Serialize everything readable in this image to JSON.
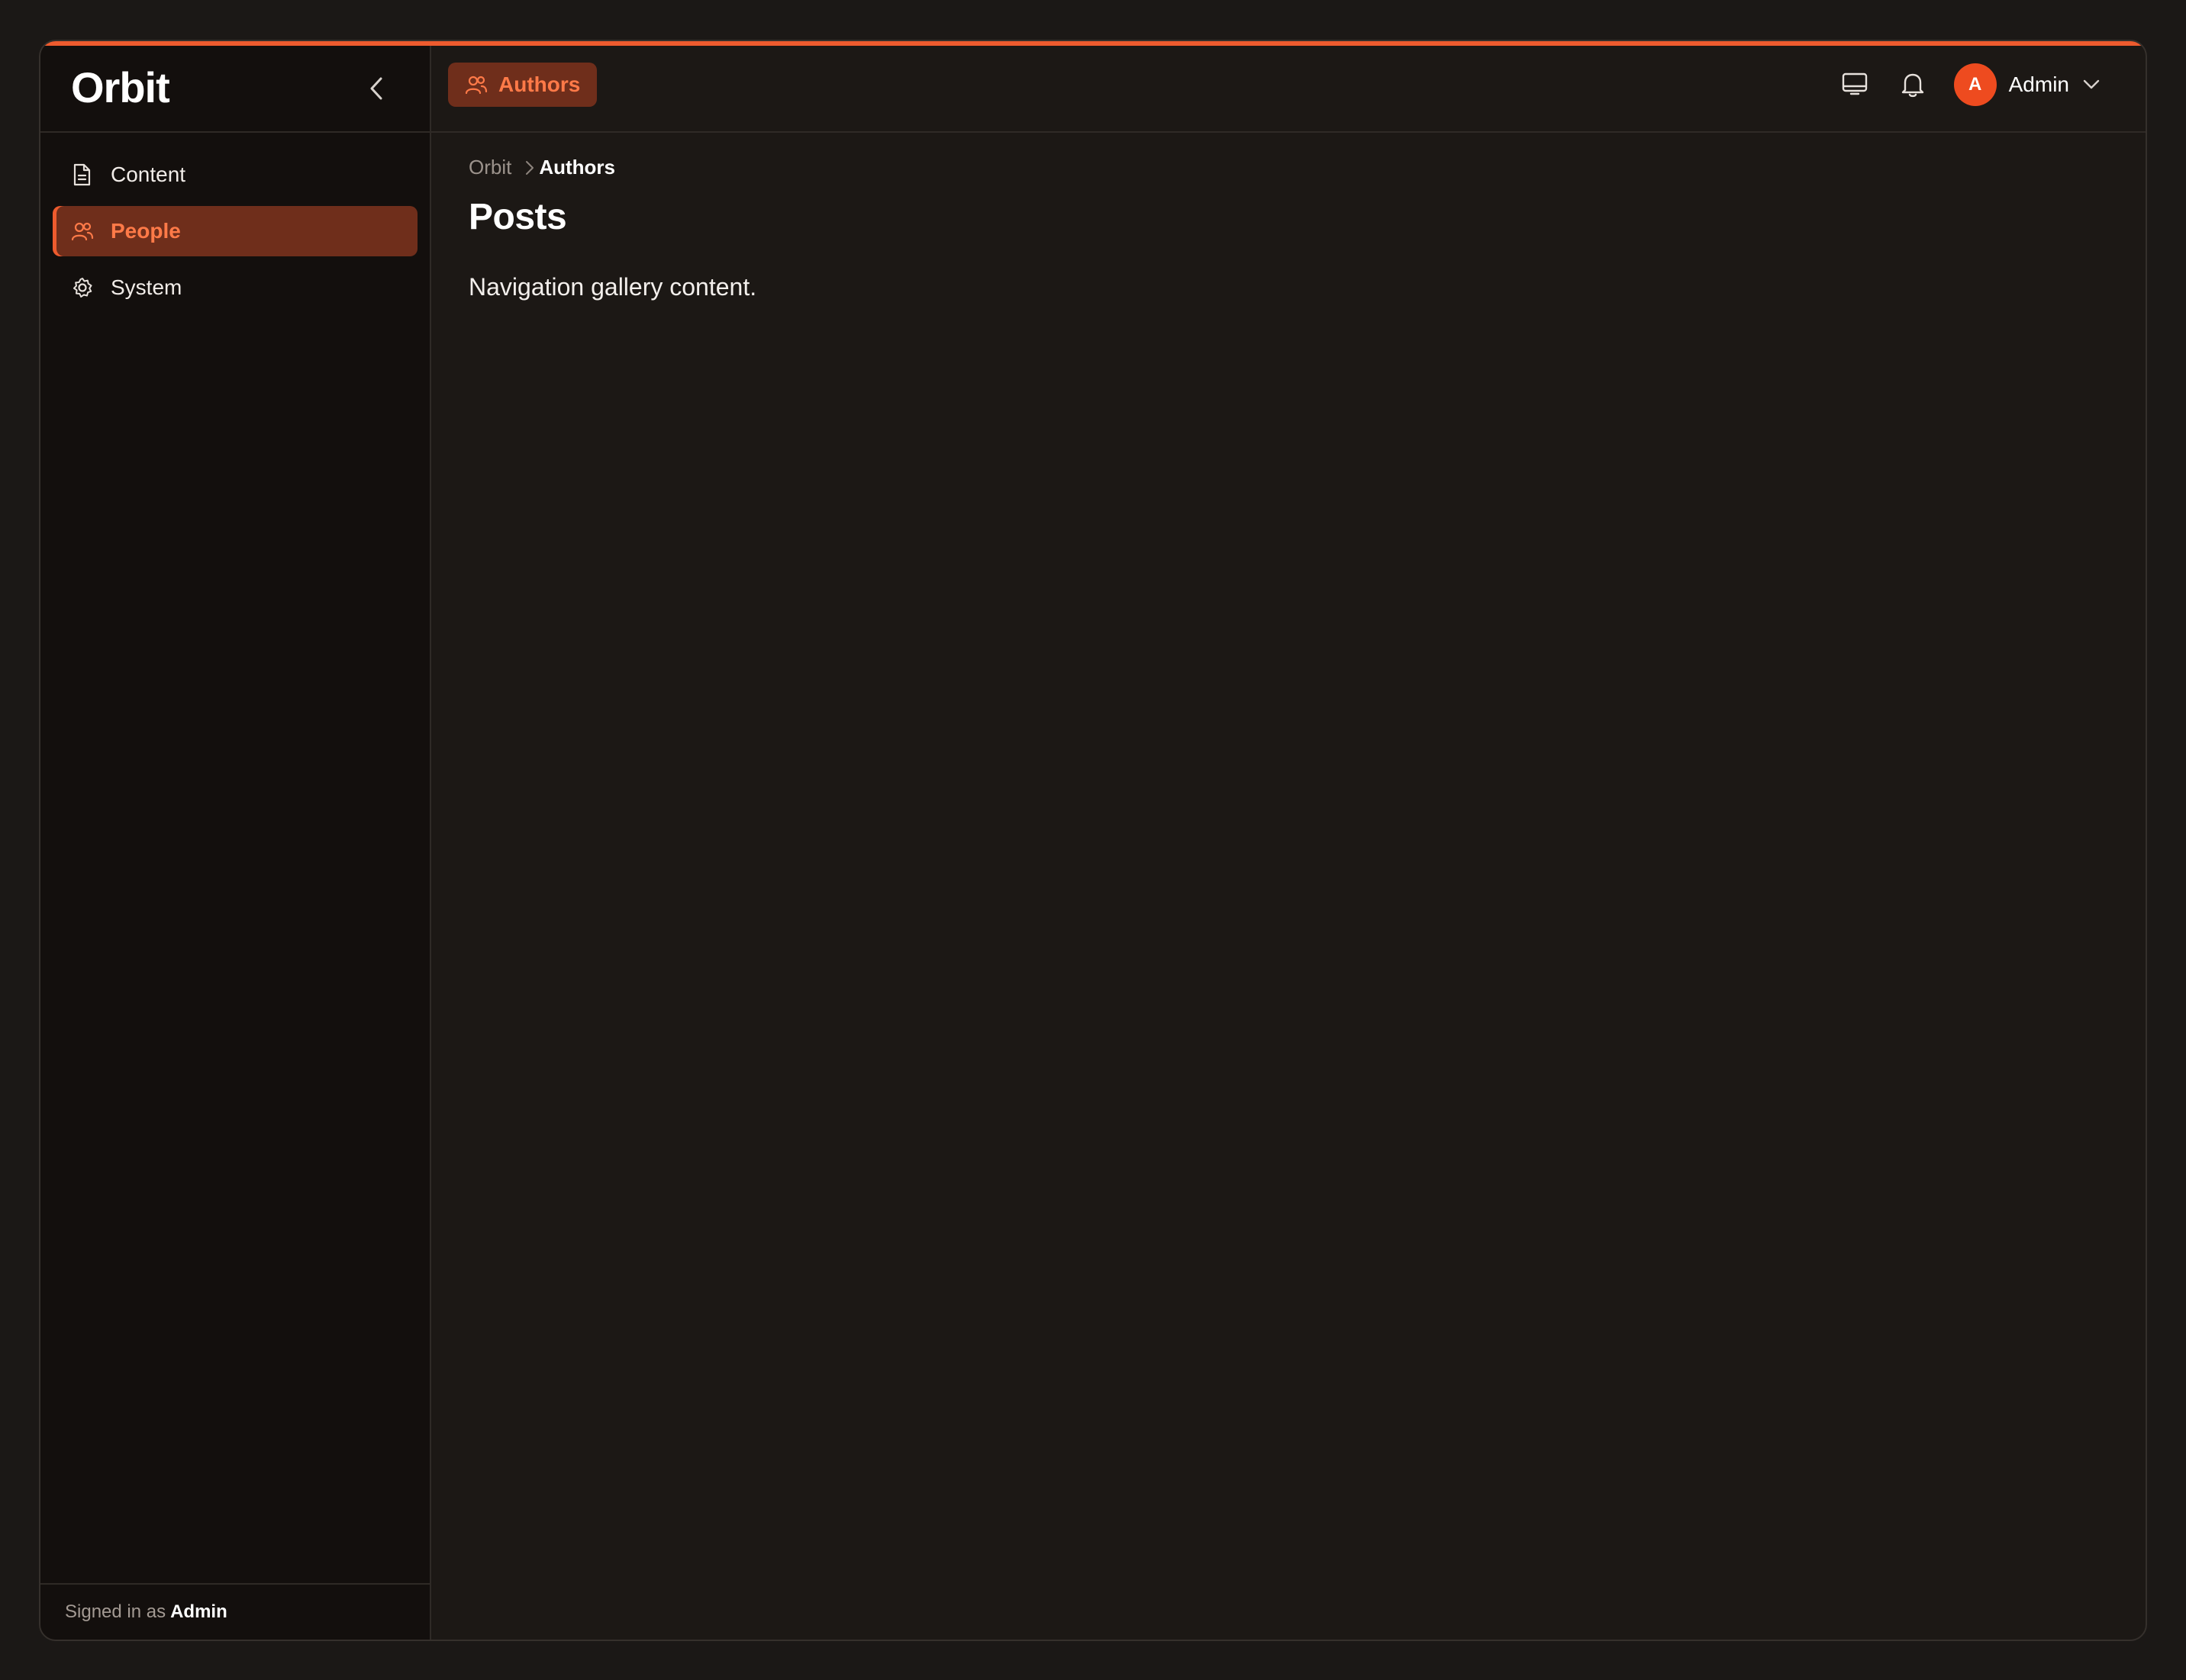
{
  "app": {
    "brand": "Orbit"
  },
  "sidebar": {
    "items": [
      {
        "label": "Content",
        "icon": "document-icon",
        "active": false
      },
      {
        "label": "People",
        "icon": "users-icon",
        "active": true
      },
      {
        "label": "System",
        "icon": "gear-icon",
        "active": false
      }
    ],
    "footer": {
      "prefix": "Signed in as",
      "user": "Admin"
    }
  },
  "topbar": {
    "section_label": "Authors",
    "user": {
      "initial": "A",
      "name": "Admin"
    }
  },
  "breadcrumb": {
    "root": "Orbit",
    "current": "Authors"
  },
  "page": {
    "title": "Posts",
    "body": "Navigation gallery content."
  },
  "colors": {
    "accent": "#ee5b2e",
    "active_bg": "#6f2e1b",
    "active_text": "#ff7a48"
  }
}
